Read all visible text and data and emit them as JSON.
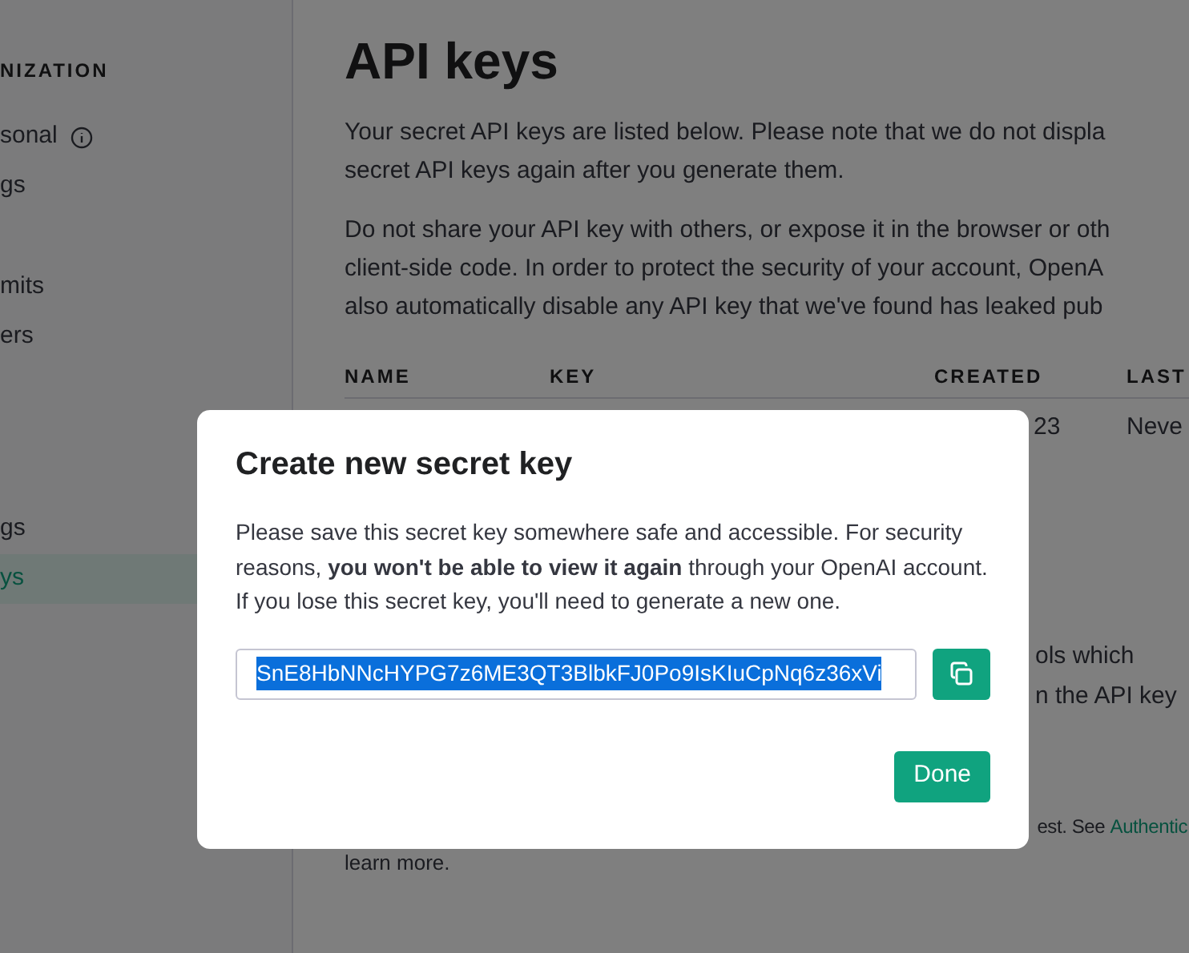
{
  "sidebar": {
    "heading": "NIZATION",
    "groups": [
      {
        "items": [
          {
            "label": "sonal",
            "info": true,
            "selected": false
          },
          {
            "label": "gs",
            "info": false,
            "selected": false
          }
        ]
      },
      {
        "items": [
          {
            "label": "mits",
            "info": false,
            "selected": false
          },
          {
            "label": "ers",
            "info": false,
            "selected": false
          }
        ]
      },
      {
        "items": [
          {
            "label": "gs",
            "info": false,
            "selected": false
          },
          {
            "label": "ys",
            "info": false,
            "selected": true
          }
        ]
      }
    ]
  },
  "page": {
    "title": "API keys",
    "paragraphs": [
      [
        "Your secret API keys are listed below. Please note that we do not displa",
        "secret API keys again after you generate them."
      ],
      [
        "Do not share your API key with others, or expose it in the browser or oth",
        "client-side code. In order to protect the security of your account, OpenA",
        "also automatically disable any API key that we've found has leaked pub"
      ]
    ],
    "table": {
      "columns": [
        "NAME",
        "KEY",
        "CREATED",
        "LAST"
      ],
      "rows": [
        {
          "created": "23",
          "last_used": "Neve"
        }
      ]
    },
    "fragments": [
      "ols which",
      "n the API key"
    ],
    "footer": {
      "text": "est. See ",
      "link": "Authentic",
      "tail": "learn more."
    }
  },
  "dialog": {
    "title": "Create new secret key",
    "message": "Please save this secret key somewhere safe and accessible. For security reasons, **you won't be able to view it again** through your OpenAI account. If you lose this secret key, you'll need to generate a new one.",
    "key": "SnE8HbNNcHYPG7z6ME3QT3BlbkFJ0Po9IsKIuCpNq6z36xVi",
    "done": "Done"
  }
}
